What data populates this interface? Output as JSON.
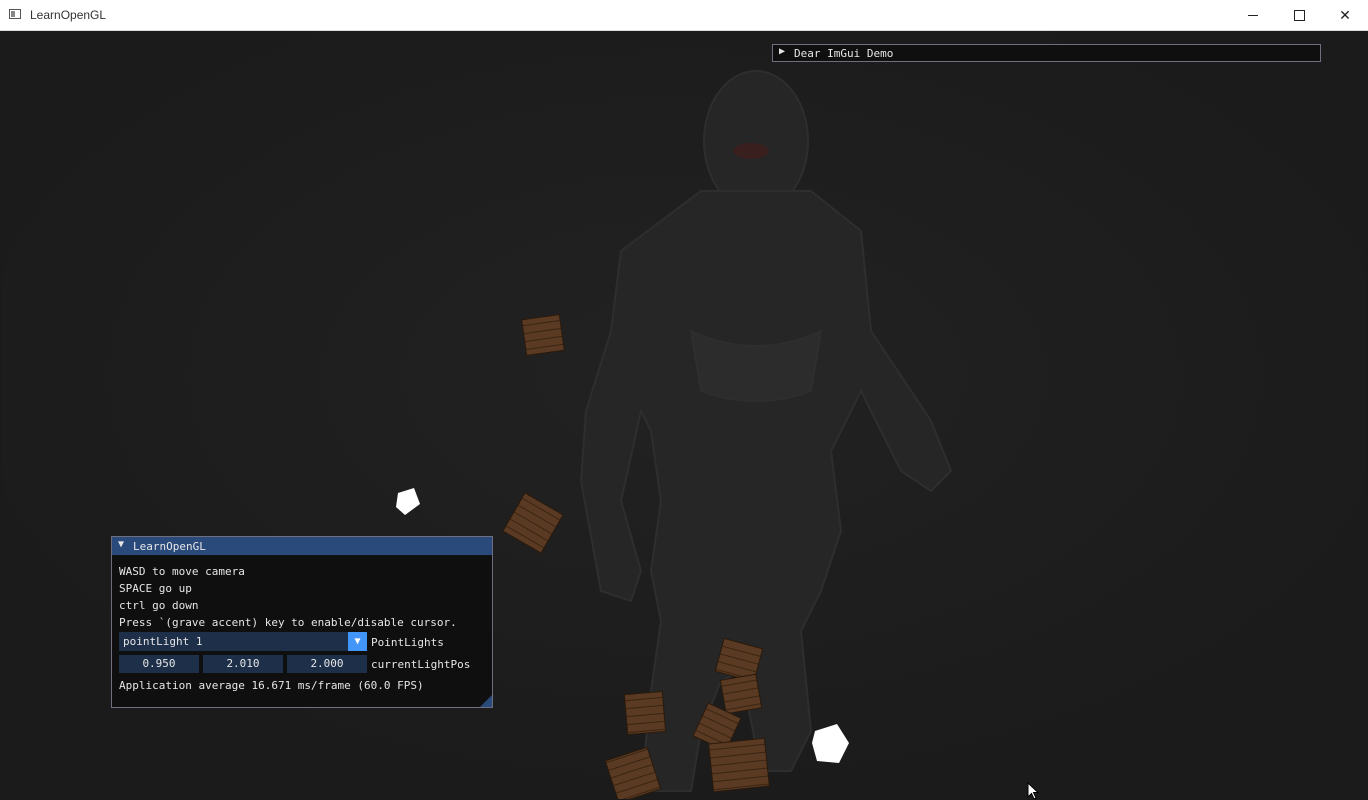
{
  "window": {
    "title": "LearnOpenGL"
  },
  "demo_window": {
    "title": "Dear ImGui Demo",
    "collapsed_icon": "triangle-right"
  },
  "panel": {
    "title": "LearnOpenGL",
    "expanded_icon": "triangle-down",
    "lines": [
      "WASD to move camera",
      "SPACE go up",
      "ctrl go down",
      "Press `(grave accent) key to enable/disable cursor."
    ],
    "combo_value": "pointLight 1",
    "combo_label": "PointLights",
    "light_pos": [
      "0.950",
      "2.010",
      "2.000"
    ],
    "light_pos_label": "currentLightPos",
    "fps_text": "Application average 16.671 ms/frame (60.0 FPS)"
  },
  "colors": {
    "imgui_title_bg": "#294a7a",
    "imgui_frame_bg": "#1d2f49",
    "imgui_button": "#4296fa"
  }
}
